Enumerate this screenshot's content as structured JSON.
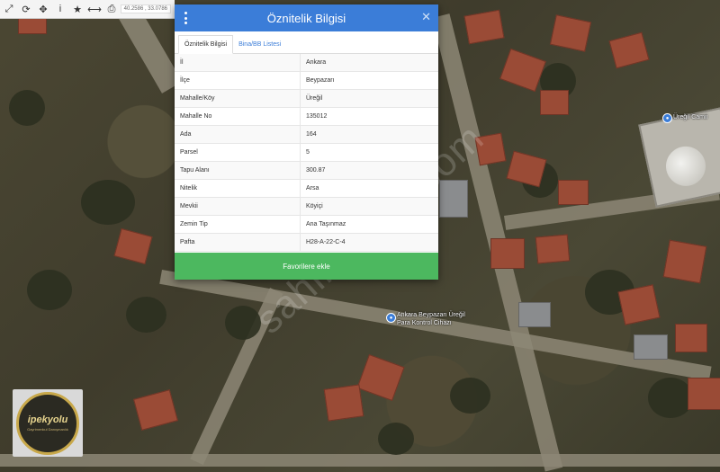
{
  "toolbar": {
    "buttons": [
      {
        "icon": "expand-icon",
        "glyph": "⤢"
      },
      {
        "icon": "refresh-icon",
        "glyph": "⟳"
      },
      {
        "icon": "move-icon",
        "glyph": "✥"
      },
      {
        "icon": "info-icon",
        "glyph": "i"
      },
      {
        "icon": "star-icon",
        "glyph": "★"
      },
      {
        "icon": "measure-icon",
        "glyph": "⟷"
      },
      {
        "icon": "print-icon",
        "glyph": "⎙"
      }
    ],
    "coords": "40.2586 , 33.0786"
  },
  "panel": {
    "title": "Öznitelik Bilgisi",
    "tabs": [
      "Öznitelik Bilgisi",
      "Bina/BB Listesi"
    ],
    "rows": [
      {
        "key": "İl",
        "value": "Ankara"
      },
      {
        "key": "İlçe",
        "value": "Beypazarı"
      },
      {
        "key": "Mahalle/Köy",
        "value": "Üreğil"
      },
      {
        "key": "Mahalle No",
        "value": "135012"
      },
      {
        "key": "Ada",
        "value": "164"
      },
      {
        "key": "Parsel",
        "value": "5"
      },
      {
        "key": "Tapu Alanı",
        "value": "300.87"
      },
      {
        "key": "Nitelik",
        "value": "Arsa"
      },
      {
        "key": "Mevkii",
        "value": "Köyiçi"
      },
      {
        "key": "Zemin Tip",
        "value": "Ana Taşınmaz"
      },
      {
        "key": "Pafta",
        "value": "H28-A-22-C-4"
      }
    ],
    "favorite_button": "Favorilere ekle"
  },
  "map": {
    "mosque_label": "Üreğil Camii",
    "device_label_line1": "Ankara Beypazarı Üreğil",
    "device_label_line2": "Para Kontrol Cihazı",
    "watermark": "sahibinden.com"
  },
  "logo": {
    "name": "ipekyolu",
    "tagline": "Gayrimenkul Danışmanlık"
  },
  "colors": {
    "header": "#3b7dd8",
    "favorite_button": "#4cb85f"
  }
}
